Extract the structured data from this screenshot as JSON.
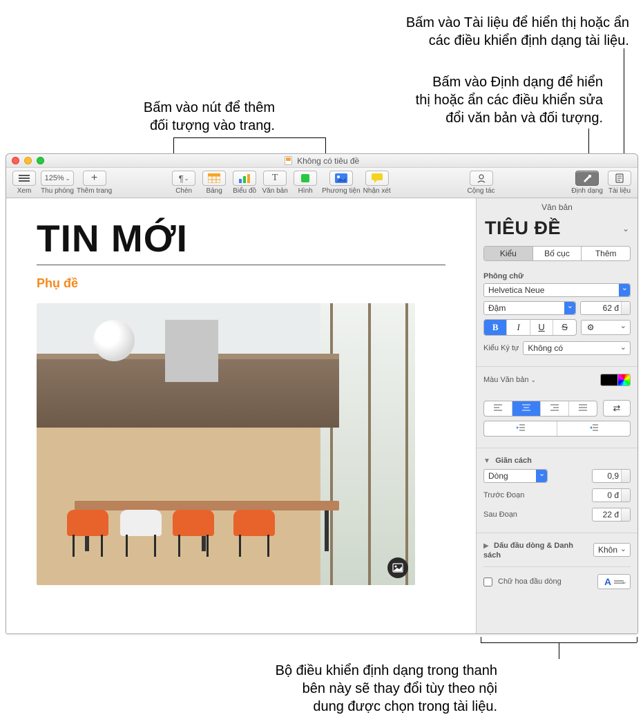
{
  "callouts": {
    "insert": "Bấm vào nút để thêm\nđối tượng vào trang.",
    "format": "Bấm vào Định dạng để hiển\nthị hoặc ẩn các điều khiển sửa\nđổi văn bản và đối tượng.",
    "document": "Bấm vào Tài liệu để hiển thị hoặc ẩn\ncác điều khiển định dạng tài liệu.",
    "sidebar": "Bộ điều khiển định dạng trong thanh\nbên này sẽ thay đổi tùy theo nội\ndung được chọn trong tài liệu."
  },
  "window": {
    "title": "Không có tiêu đề"
  },
  "toolbar": {
    "view": "Xem",
    "zoom_value": "125%",
    "zoom_label": "Thu phóng",
    "addpage": "Thêm trang",
    "insert": "Chèn",
    "table": "Bảng",
    "chart": "Biểu đồ",
    "text": "Văn bản",
    "shape": "Hình",
    "media": "Phương tiện",
    "comment": "Nhận xét",
    "collab": "Cộng tác",
    "format": "Định dạng",
    "document": "Tài liệu"
  },
  "doc": {
    "headline": "TIN MỚI",
    "subtitle": "Phụ đề"
  },
  "sidebar": {
    "header": "Văn bản",
    "style_name": "TIÊU ĐỀ",
    "tabs": {
      "style": "Kiểu",
      "layout": "Bố cục",
      "more": "Thêm"
    },
    "font_label": "Phông chữ",
    "font_family": "Helvetica Neue",
    "font_weight": "Đậm",
    "font_size": "62 đ",
    "char_style_label": "Kiểu Ký tự",
    "char_style_value": "Không có",
    "text_color_label": "Màu Văn bản",
    "spacing_label": "Giãn cách",
    "spacing_mode": "Dòng",
    "spacing_value": "0,9",
    "before_label": "Trước Đoạn",
    "before_value": "0 đ",
    "after_label": "Sau Đoạn",
    "after_value": "22 đ",
    "bullets_label": "Dấu đầu dòng & Danh sách",
    "bullets_value": "Khôn",
    "dropcap_label": "Chữ hoa đầu dòng"
  }
}
